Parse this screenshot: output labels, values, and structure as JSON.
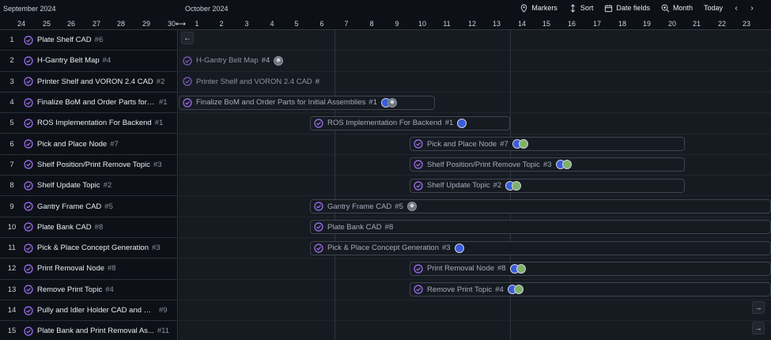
{
  "header": {
    "month_left": "September 2024",
    "month_right": "October 2024",
    "days": [
      "24",
      "25",
      "26",
      "27",
      "28",
      "29",
      "30",
      "1",
      "2",
      "3",
      "4",
      "5",
      "6",
      "7",
      "8",
      "9",
      "10",
      "11",
      "12",
      "13",
      "14",
      "15",
      "16",
      "17",
      "18",
      "19",
      "20",
      "21",
      "22",
      "23"
    ]
  },
  "toolbar": {
    "markers_label": "Markers",
    "sort_label": "Sort",
    "date_fields_label": "Date fields",
    "month_label": "Month",
    "today_label": "Today",
    "prev_icon": "chevron-left-icon",
    "next_icon": "chevron-right-icon"
  },
  "rows": [
    {
      "num": "1",
      "title": "Plate Shelf CAD",
      "id": "#6"
    },
    {
      "num": "2",
      "title": "H-Gantry Belt Map",
      "id": "#4"
    },
    {
      "num": "3",
      "title": "Printer Shelf and VORON 2.4 CAD",
      "id": "#2"
    },
    {
      "num": "4",
      "title": "Finalize BoM and Order Parts for I...",
      "id": "#1"
    },
    {
      "num": "5",
      "title": "ROS Implementation For Backend",
      "id": "#1"
    },
    {
      "num": "6",
      "title": "Pick and Place Node",
      "id": "#7"
    },
    {
      "num": "7",
      "title": "Shelf Position/Print Remove Topic",
      "id": "#3"
    },
    {
      "num": "8",
      "title": "Shelf Update Topic",
      "id": "#2"
    },
    {
      "num": "9",
      "title": "Gantry Frame CAD",
      "id": "#5"
    },
    {
      "num": "10",
      "title": "Plate Bank CAD",
      "id": "#8"
    },
    {
      "num": "11",
      "title": "Pick & Place Concept Generation",
      "id": "#3"
    },
    {
      "num": "12",
      "title": "Print Removal Node",
      "id": "#8"
    },
    {
      "num": "13",
      "title": "Remove Print Topic",
      "id": "#4"
    },
    {
      "num": "14",
      "title": "Pully and Idler Holder CAD and Pl...",
      "id": "#9"
    },
    {
      "num": "15",
      "title": "Plate Bank and Print Removal As...",
      "id": "#11"
    }
  ],
  "bars": [
    {
      "label": "H-Gantry Belt Map",
      "id": "#4",
      "avatars": [
        "a1"
      ]
    },
    {
      "label": "Printer Shelf and VORON 2.4 CAD",
      "id": "#2",
      "avatars": []
    },
    {
      "label": "Finalize BoM and Order Parts for Initial Assemblies",
      "id": "#1",
      "avatars": [
        "a2",
        "a1"
      ]
    },
    {
      "label": "ROS Implementation For Backend",
      "id": "#1",
      "avatars": [
        "a2"
      ]
    },
    {
      "label": "Pick and Place Node",
      "id": "#7",
      "avatars": [
        "a2",
        "a3"
      ]
    },
    {
      "label": "Shelf Position/Print Remove Topic",
      "id": "#3",
      "avatars": [
        "a2",
        "a3"
      ]
    },
    {
      "label": "Shelf Update Topic",
      "id": "#2",
      "avatars": [
        "a2",
        "a3"
      ]
    },
    {
      "label": "Gantry Frame CAD",
      "id": "#5",
      "avatars": [
        "a1"
      ]
    },
    {
      "label": "Plate Bank CAD",
      "id": "#8",
      "avatars": []
    },
    {
      "label": "Pick & Place Concept Generation",
      "id": "#3",
      "avatars": [
        "a2"
      ]
    },
    {
      "label": "Print Removal Node",
      "id": "#8",
      "avatars": [
        "a2",
        "a3"
      ]
    },
    {
      "label": "Remove Print Topic",
      "id": "#4",
      "avatars": [
        "a2",
        "a3"
      ]
    }
  ],
  "colors": {
    "background": "#0d1117",
    "chart_background": "#161b22",
    "check_icon": "#a371f7",
    "border": "#30363d"
  }
}
